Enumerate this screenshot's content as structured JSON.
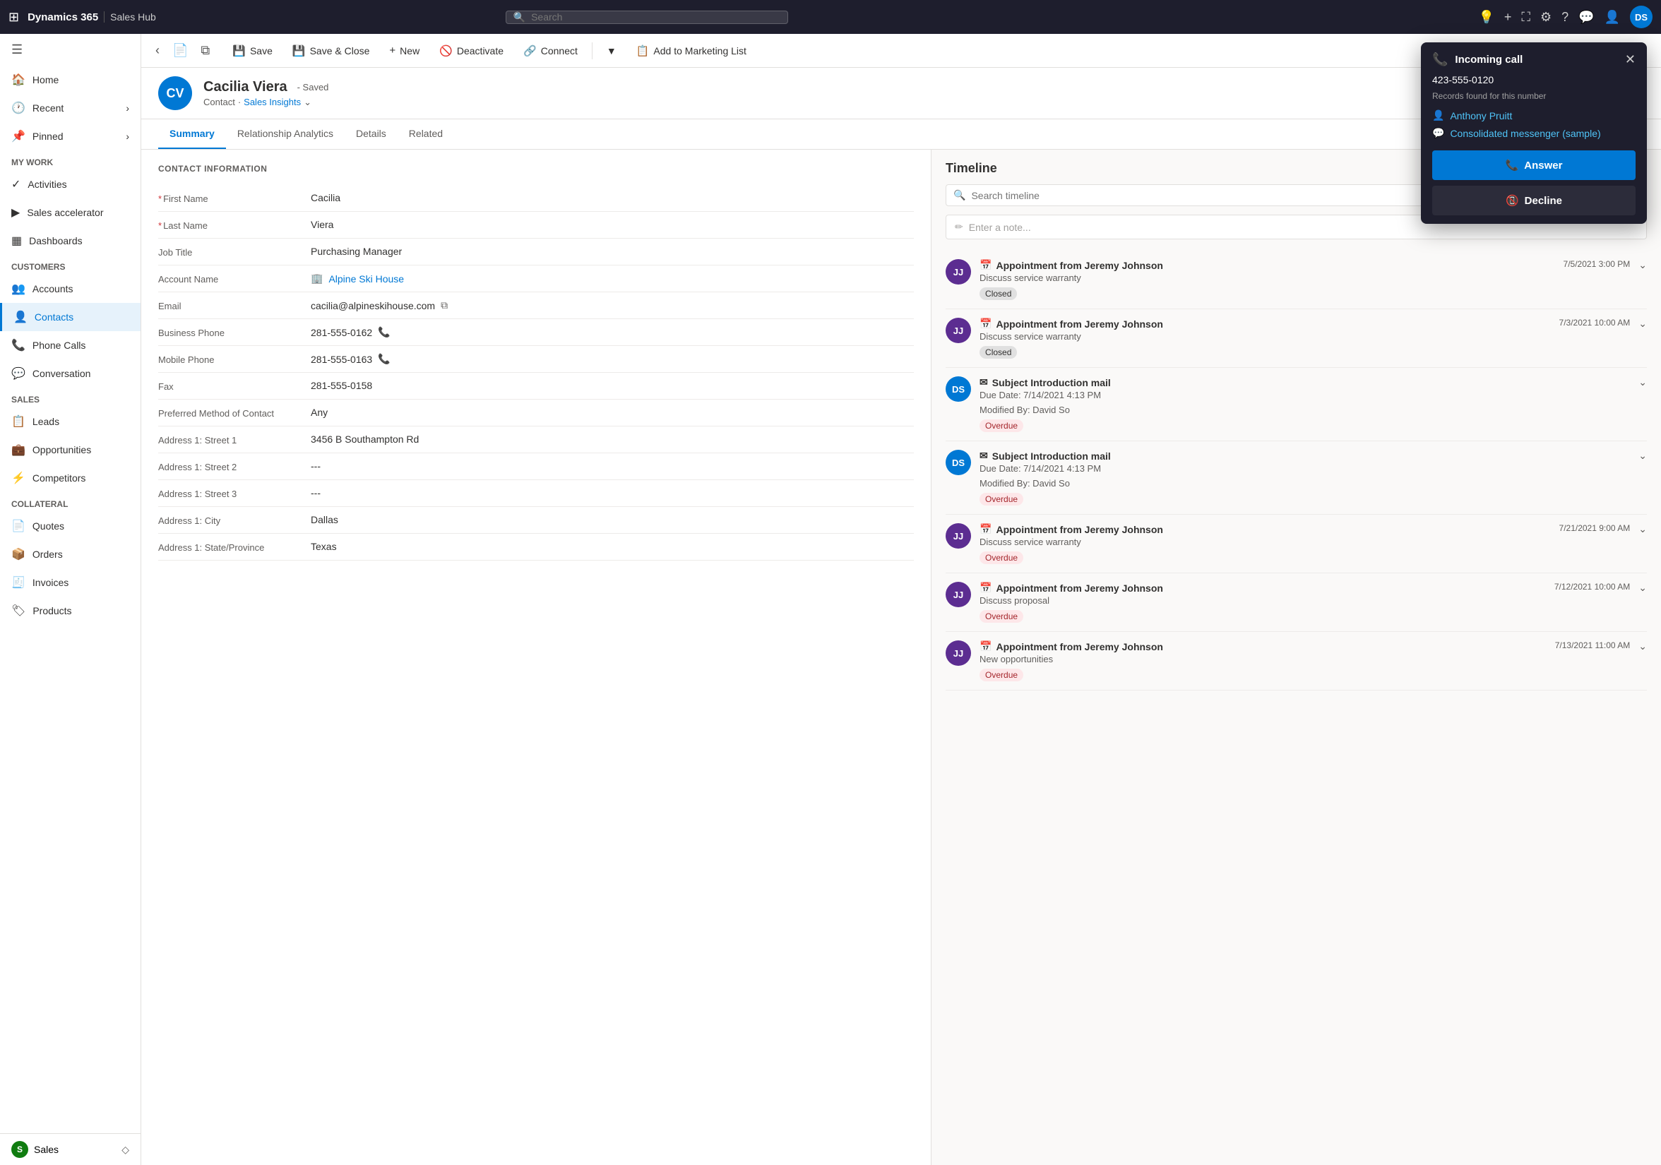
{
  "topNav": {
    "gridIcon": "⊞",
    "brandName": "Dynamics 365",
    "appName": "Sales Hub",
    "searchPlaceholder": "Search",
    "navIcons": [
      "💡",
      "+",
      "⛶",
      "⚙",
      "?",
      "💬",
      "👤"
    ],
    "avatarLabel": "DS"
  },
  "sidebar": {
    "toggleIcon": "☰",
    "items": [
      {
        "id": "home",
        "icon": "🏠",
        "label": "Home"
      },
      {
        "id": "recent",
        "icon": "🕐",
        "label": "Recent",
        "hasChevron": true
      },
      {
        "id": "pinned",
        "icon": "📌",
        "label": "Pinned",
        "hasChevron": true
      }
    ],
    "sections": [
      {
        "label": "My Work",
        "items": [
          {
            "id": "activities",
            "icon": "✓",
            "label": "Activities"
          },
          {
            "id": "sales-accelerator",
            "icon": "▶",
            "label": "Sales accelerator"
          },
          {
            "id": "dashboards",
            "icon": "▦",
            "label": "Dashboards"
          }
        ]
      },
      {
        "label": "Customers",
        "items": [
          {
            "id": "accounts",
            "icon": "👥",
            "label": "Accounts"
          },
          {
            "id": "contacts",
            "icon": "👤",
            "label": "Contacts",
            "active": true
          },
          {
            "id": "phone-calls",
            "icon": "📞",
            "label": "Phone Calls"
          },
          {
            "id": "conversation",
            "icon": "💬",
            "label": "Conversation"
          }
        ]
      },
      {
        "label": "Sales",
        "items": [
          {
            "id": "leads",
            "icon": "📋",
            "label": "Leads"
          },
          {
            "id": "opportunities",
            "icon": "💼",
            "label": "Opportunities"
          },
          {
            "id": "competitors",
            "icon": "⚡",
            "label": "Competitors"
          }
        ]
      },
      {
        "label": "Collateral",
        "items": [
          {
            "id": "quotes",
            "icon": "📄",
            "label": "Quotes"
          },
          {
            "id": "orders",
            "icon": "📦",
            "label": "Orders"
          },
          {
            "id": "invoices",
            "icon": "🧾",
            "label": "Invoices"
          },
          {
            "id": "products",
            "icon": "🏷",
            "label": "Products"
          }
        ]
      },
      {
        "label": "Sales",
        "sectionIcon": "S",
        "items": []
      }
    ]
  },
  "commandBar": {
    "saveLabel": "Save",
    "saveCloseLabel": "Save & Close",
    "newLabel": "New",
    "deactivateLabel": "Deactivate",
    "connectLabel": "Connect",
    "addToMarketingListLabel": "Add to Marketing List",
    "moreIcon": "▼"
  },
  "record": {
    "initials": "CV",
    "name": "Cacilia Viera",
    "savedLabel": "- Saved",
    "type": "Contact",
    "view": "Sales Insights",
    "tabs": [
      "Summary",
      "Relationship Analytics",
      "Details",
      "Related"
    ],
    "activeTab": "Summary"
  },
  "contactInfo": {
    "sectionTitle": "CONTACT INFORMATION",
    "fields": [
      {
        "label": "First Name",
        "value": "Cacilia",
        "required": true
      },
      {
        "label": "Last Name",
        "value": "Viera",
        "required": true
      },
      {
        "label": "Job Title",
        "value": "Purchasing Manager",
        "required": false
      },
      {
        "label": "Account Name",
        "value": "Alpine Ski House",
        "isLink": true,
        "required": false
      },
      {
        "label": "Email",
        "value": "cacilia@alpineskihouse.com",
        "hasIcon": true,
        "required": false
      },
      {
        "label": "Business Phone",
        "value": "281-555-0162",
        "hasIcon": true,
        "required": false
      },
      {
        "label": "Mobile Phone",
        "value": "281-555-0163",
        "hasIcon": true,
        "required": false
      },
      {
        "label": "Fax",
        "value": "281-555-0158",
        "required": false
      },
      {
        "label": "Preferred Method of Contact",
        "value": "Any",
        "required": false
      },
      {
        "label": "Address 1: Street 1",
        "value": "3456 B Southampton Rd",
        "required": false
      },
      {
        "label": "Address 1: Street 2",
        "value": "---",
        "required": false
      },
      {
        "label": "Address 1: Street 3",
        "value": "---",
        "required": false
      },
      {
        "label": "Address 1: City",
        "value": "Dallas",
        "required": false
      },
      {
        "label": "Address 1: State/Province",
        "value": "Texas",
        "required": false
      }
    ]
  },
  "timeline": {
    "header": "Timeline",
    "searchPlaceholder": "Search timeline",
    "notePlaceholder": "Enter a note...",
    "items": [
      {
        "initials": "JJ",
        "avatarColor": "#5c2d91",
        "icon": "📅",
        "title": "Appointment from Jeremy Johnson",
        "description": "Discuss service warranty",
        "badge": "Closed",
        "badgeType": "closed",
        "date": "7/5/2021 3:00 PM",
        "hasChevron": true
      },
      {
        "initials": "JJ",
        "avatarColor": "#5c2d91",
        "icon": "📅",
        "title": "Appointment from Jeremy Johnson",
        "description": "Discuss service warranty",
        "badge": "Closed",
        "badgeType": "closed",
        "date": "7/3/2021 10:00 AM",
        "hasChevron": true
      },
      {
        "initials": "DS",
        "avatarColor": "#0078d4",
        "icon": "✉",
        "title": "Subject Introduction mail",
        "description": "Due Date: 7/14/2021 4:13 PM",
        "extraLine": "Modified By: David So",
        "badge": "Overdue",
        "badgeType": "overdue",
        "hasChevron": true
      },
      {
        "initials": "DS",
        "avatarColor": "#0078d4",
        "icon": "✉",
        "title": "Subject Introduction mail",
        "description": "Due Date: 7/14/2021 4:13 PM",
        "extraLine": "Modified By: David So",
        "badge": "Overdue",
        "badgeType": "overdue",
        "hasChevron": true
      },
      {
        "initials": "JJ",
        "avatarColor": "#5c2d91",
        "icon": "📅",
        "title": "Appointment from Jeremy Johnson",
        "description": "Discuss service warranty",
        "badge": "Overdue",
        "badgeType": "overdue",
        "date": "7/21/2021 9:00 AM",
        "hasChevron": true
      },
      {
        "initials": "JJ",
        "avatarColor": "#5c2d91",
        "icon": "📅",
        "title": "Appointment from Jeremy Johnson",
        "description": "Discuss proposal",
        "badge": "Overdue",
        "badgeType": "overdue",
        "date": "7/12/2021 10:00 AM",
        "hasChevron": true
      },
      {
        "initials": "JJ",
        "avatarColor": "#5c2d91",
        "icon": "📅",
        "title": "Appointment from Jeremy Johnson",
        "description": "New opportunities",
        "badge": "Overdue",
        "badgeType": "overdue",
        "date": "7/13/2021 11:00 AM",
        "hasChevron": true
      }
    ]
  },
  "incomingCall": {
    "title": "Incoming call",
    "phoneIcon": "📞",
    "number": "423-555-0120",
    "recordsLabel": "Records found for this number",
    "records": [
      {
        "icon": "👤",
        "name": "Anthony Pruitt",
        "type": "contact"
      },
      {
        "icon": "💬",
        "name": "Consolidated messenger (sample)",
        "type": "account"
      }
    ],
    "answerLabel": "Answer",
    "declineLabel": "Decline"
  }
}
